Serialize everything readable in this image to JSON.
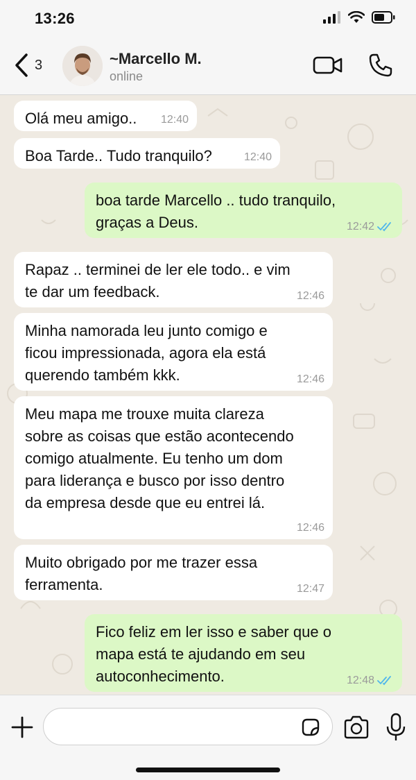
{
  "status_bar": {
    "time": "13:26"
  },
  "header": {
    "back_count": "3",
    "contact_name": "~Marcello M.",
    "contact_status": "online"
  },
  "messages": [
    {
      "direction": "in",
      "text": "Olá meu amigo..",
      "time": "12:40"
    },
    {
      "direction": "in",
      "text": "Boa Tarde.. Tudo tranquilo?",
      "time": "12:40"
    },
    {
      "direction": "out",
      "text": "boa tarde Marcello .. tudo tranquilo,\ngraças a Deus.",
      "time": "12:42",
      "status": "read"
    },
    {
      "direction": "in",
      "text": "Rapaz .. terminei de ler ele todo.. e vim\nte dar um feedback.",
      "time": "12:46"
    },
    {
      "direction": "in",
      "text": "Minha namorada leu junto comigo e\nficou impressionada, agora ela está\nquerendo também kkk.",
      "time": "12:46"
    },
    {
      "direction": "in",
      "text": "Meu mapa me trouxe muita clareza\nsobre as coisas que estão acontecendo\ncomigo atualmente. Eu tenho um dom\npara liderança e busco por isso dentro\nda empresa desde que eu entrei lá.",
      "time": "12:46"
    },
    {
      "direction": "in",
      "text": "Muito obrigado por me trazer essa\nferramenta.",
      "time": "12:47"
    },
    {
      "direction": "out",
      "text": "Fico feliz em ler isso e saber que o\nmapa está te ajudando em seu\nautoconhecimento.",
      "time": "12:48",
      "status": "read"
    }
  ],
  "input": {
    "placeholder": ""
  },
  "colors": {
    "chat_bg": "#efeae2",
    "incoming_bubble": "#ffffff",
    "outgoing_bubble": "#dcf8c6",
    "read_tick": "#4fb6ec"
  },
  "icons": [
    "back-chevron-icon",
    "video-call-icon",
    "phone-icon",
    "plus-icon",
    "sticker-icon",
    "camera-icon",
    "mic-icon",
    "read-receipt-icon"
  ]
}
